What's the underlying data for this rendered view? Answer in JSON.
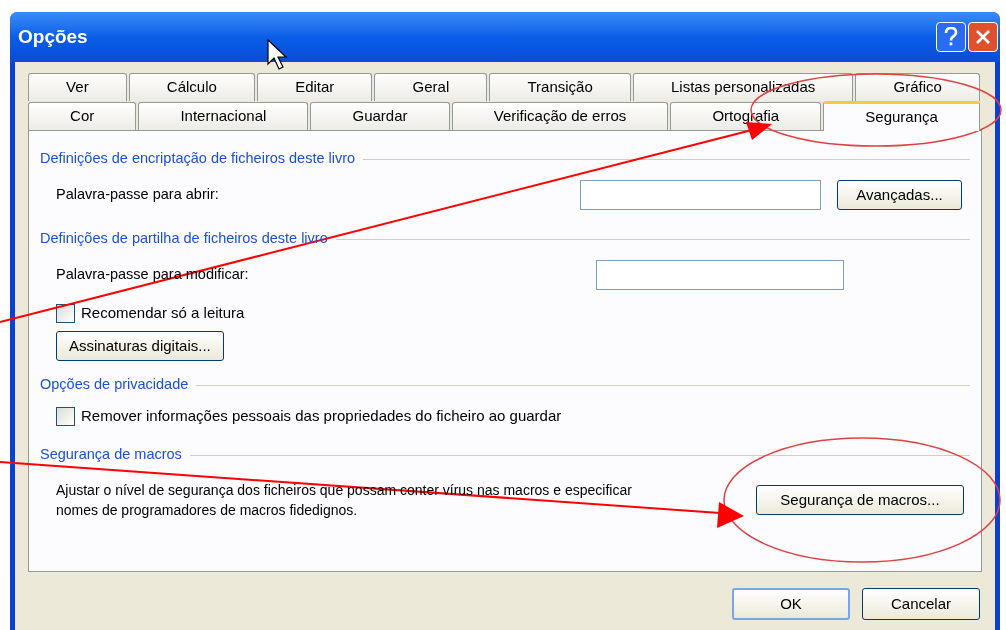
{
  "window": {
    "title": "Opções"
  },
  "tab_rows": [
    [
      {
        "label": "Ver",
        "selected": false
      },
      {
        "label": "Cálculo",
        "selected": false
      },
      {
        "label": "Editar",
        "selected": false
      },
      {
        "label": "Geral",
        "selected": false
      },
      {
        "label": "Transição",
        "selected": false
      },
      {
        "label": "Listas personalizadas",
        "selected": false
      },
      {
        "label": "Gráfico",
        "selected": false
      }
    ],
    [
      {
        "label": "Cor",
        "selected": false
      },
      {
        "label": "Internacional",
        "selected": false
      },
      {
        "label": "Guardar",
        "selected": false
      },
      {
        "label": "Verificação de erros",
        "selected": false
      },
      {
        "label": "Ortografia",
        "selected": false
      },
      {
        "label": "Segurança",
        "selected": true
      }
    ]
  ],
  "sections": [
    {
      "title": "Definições de encriptação de ficheiros deste livro",
      "items": [
        {
          "kind": "field",
          "label": "Palavra-passe para abrir:",
          "button": "Avançadas..."
        }
      ]
    },
    {
      "title": "Definições de partilha de ficheiros deste livro",
      "items": [
        {
          "kind": "field",
          "label": "Palavra-passe para modificar:"
        },
        {
          "kind": "checkbox",
          "label": "Recomendar só a leitura",
          "checked": false
        },
        {
          "kind": "button",
          "label": "Assinaturas digitais..."
        }
      ]
    },
    {
      "title": "Opções de privacidade",
      "items": [
        {
          "kind": "checkbox",
          "label": "Remover informações pessoais das propriedades do ficheiro ao guardar",
          "checked": false
        }
      ]
    },
    {
      "title": "Segurança de macros",
      "items": [
        {
          "kind": "text_button",
          "text": "Ajustar o nível de segurança dos ficheiros que possam conter vírus nas macros e especificar nomes de programadores de macros fidedignos.",
          "button": "Segurança de macros..."
        }
      ]
    }
  ],
  "buttons": [
    "OK",
    "Cancelar"
  ]
}
